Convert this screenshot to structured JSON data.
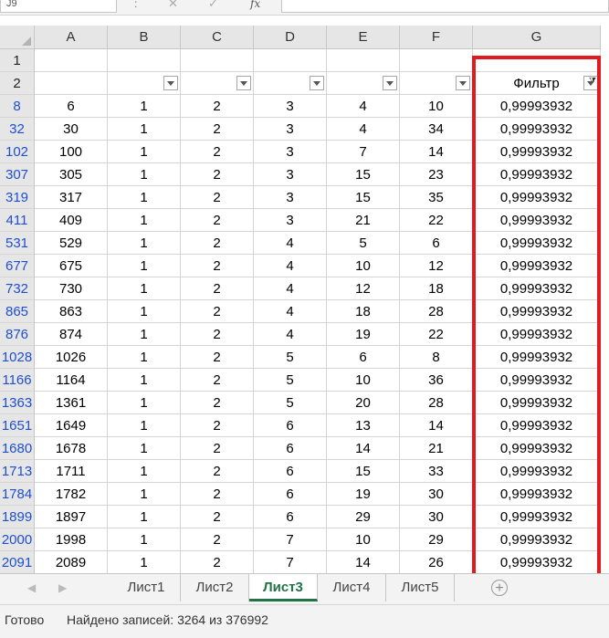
{
  "formula_bar": {
    "name_box": "J9",
    "separator": ":",
    "cancel_icon": "✕",
    "confirm_icon": "✓",
    "fx_label": "fx"
  },
  "columns": [
    "A",
    "B",
    "C",
    "D",
    "E",
    "F",
    "G"
  ],
  "row_headers": [
    "1",
    "2",
    "8",
    "32",
    "102",
    "307",
    "319",
    "411",
    "531",
    "677",
    "732",
    "865",
    "876",
    "1028",
    "1166",
    "1363",
    "1651",
    "1680",
    "1713",
    "1784",
    "1899",
    "2000",
    "2091"
  ],
  "header_row": {
    "g_label": "Фильтр"
  },
  "rows": [
    [
      "6",
      "1",
      "2",
      "3",
      "4",
      "10",
      "0,99993932"
    ],
    [
      "30",
      "1",
      "2",
      "3",
      "4",
      "34",
      "0,99993932"
    ],
    [
      "100",
      "1",
      "2",
      "3",
      "7",
      "14",
      "0,99993932"
    ],
    [
      "305",
      "1",
      "2",
      "3",
      "15",
      "23",
      "0,99993932"
    ],
    [
      "317",
      "1",
      "2",
      "3",
      "15",
      "35",
      "0,99993932"
    ],
    [
      "409",
      "1",
      "2",
      "3",
      "21",
      "22",
      "0,99993932"
    ],
    [
      "529",
      "1",
      "2",
      "4",
      "5",
      "6",
      "0,99993932"
    ],
    [
      "675",
      "1",
      "2",
      "4",
      "10",
      "12",
      "0,99993932"
    ],
    [
      "730",
      "1",
      "2",
      "4",
      "12",
      "18",
      "0,99993932"
    ],
    [
      "863",
      "1",
      "2",
      "4",
      "18",
      "28",
      "0,99993932"
    ],
    [
      "874",
      "1",
      "2",
      "4",
      "19",
      "22",
      "0,99993932"
    ],
    [
      "1026",
      "1",
      "2",
      "5",
      "6",
      "8",
      "0,99993932"
    ],
    [
      "1164",
      "1",
      "2",
      "5",
      "10",
      "36",
      "0,99993932"
    ],
    [
      "1361",
      "1",
      "2",
      "5",
      "20",
      "28",
      "0,99993932"
    ],
    [
      "1649",
      "1",
      "2",
      "6",
      "13",
      "14",
      "0,99993932"
    ],
    [
      "1678",
      "1",
      "2",
      "6",
      "14",
      "21",
      "0,99993932"
    ],
    [
      "1711",
      "1",
      "2",
      "6",
      "15",
      "33",
      "0,99993932"
    ],
    [
      "1782",
      "1",
      "2",
      "6",
      "19",
      "30",
      "0,99993932"
    ],
    [
      "1897",
      "1",
      "2",
      "6",
      "29",
      "30",
      "0,99993932"
    ],
    [
      "1998",
      "1",
      "2",
      "7",
      "10",
      "29",
      "0,99993932"
    ],
    [
      "2089",
      "1",
      "2",
      "7",
      "14",
      "26",
      "0,99993932"
    ]
  ],
  "tabs": [
    "Лист1",
    "Лист2",
    "Лист3",
    "Лист4",
    "Лист5"
  ],
  "active_tab": "Лист3",
  "add_sheet_icon": "+",
  "status": {
    "ready": "Готово",
    "found": "Найдено записей: 3264 из 376992"
  },
  "colors": {
    "highlight": "#e2191e",
    "filtered_row_header": "#1f4fcf",
    "active_tab": "#217346"
  }
}
